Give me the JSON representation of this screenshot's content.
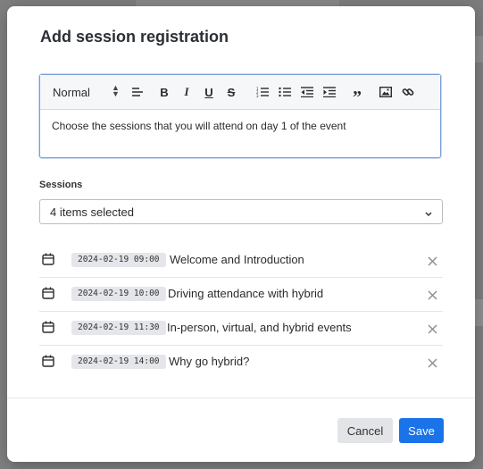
{
  "dialog": {
    "title": "Add session registration"
  },
  "editor": {
    "format_value": "Normal",
    "toolbar_icons": [
      "align-left-icon",
      "bold-icon",
      "italic-icon",
      "underline-icon",
      "strikethrough-icon",
      "ordered-list-icon",
      "bullet-list-icon",
      "outdent-icon",
      "indent-icon",
      "quote-icon",
      "image-icon",
      "link-icon"
    ],
    "content": "Choose the sessions that you will attend on day 1 of the event"
  },
  "sessions": {
    "label": "Sessions",
    "selected_text": "4 items selected",
    "items": [
      {
        "date": "2024-02-19 09:00",
        "title": "Welcome and Introduction"
      },
      {
        "date": "2024-02-19 10:00",
        "title": "Driving attendance with hybrid"
      },
      {
        "date": "2024-02-19 11:30",
        "title": "In-person, virtual, and hybrid events"
      },
      {
        "date": "2024-02-19 14:00",
        "title": "Why go hybrid?"
      }
    ]
  },
  "footer": {
    "cancel_label": "Cancel",
    "save_label": "Save"
  },
  "colors": {
    "primary": "#1a73e8",
    "editor_focus": "#7a9fd6",
    "chip_bg": "#e4e6ea"
  }
}
